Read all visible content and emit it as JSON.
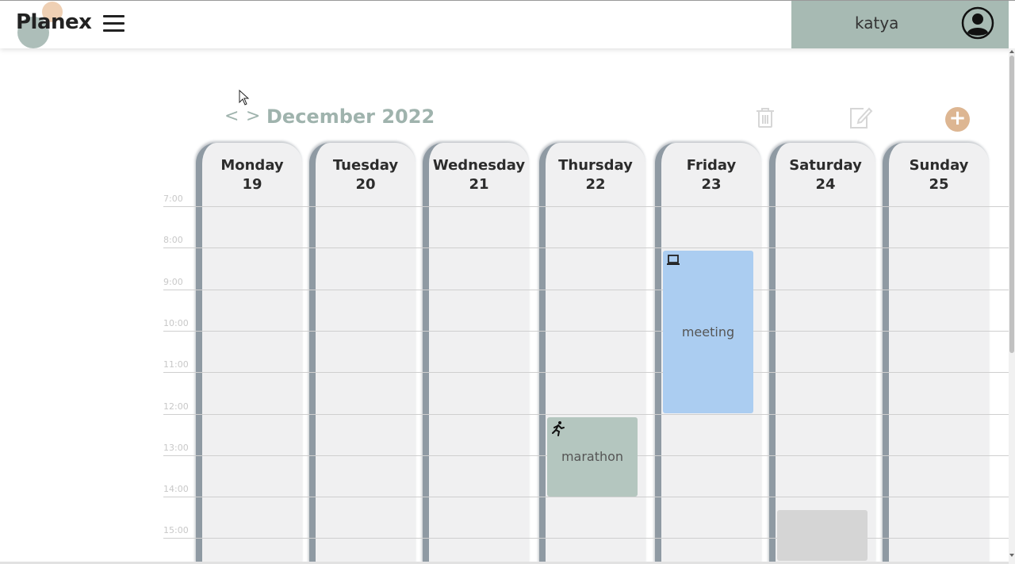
{
  "app": {
    "logo": "Planex"
  },
  "header": {
    "username": "katya"
  },
  "calendar": {
    "month_title": "December 2022",
    "prev_label": "<",
    "next_label": ">",
    "add_label": "+",
    "time_labels": [
      "7:00",
      "8:00",
      "9:00",
      "10:00",
      "11:00",
      "12:00",
      "13:00",
      "14:00",
      "15:00"
    ],
    "days": [
      {
        "name": "Monday",
        "num": "19"
      },
      {
        "name": "Tuesday",
        "num": "20"
      },
      {
        "name": "Wednesday",
        "num": "21"
      },
      {
        "name": "Thursday",
        "num": "22"
      },
      {
        "name": "Friday",
        "num": "23"
      },
      {
        "name": "Saturday",
        "num": "24"
      },
      {
        "name": "Sunday",
        "num": "25"
      }
    ],
    "events": [
      {
        "title": "meeting",
        "day": "Friday",
        "icon": "laptop-icon",
        "color": "#abcdf1",
        "start": "8:00",
        "end": "12:00"
      },
      {
        "title": "marathon",
        "day": "Thursday",
        "icon": "running-icon",
        "color": "#b4c6bf",
        "start": "12:00",
        "end": "14:00"
      },
      {
        "title": "",
        "day": "Saturday",
        "icon": "",
        "color": "#d5d5d5",
        "start": "14:15",
        "end": ""
      }
    ]
  },
  "colors": {
    "accent": "#9fb3ad",
    "add_button": "#ddb692",
    "user_box": "#a7bab3"
  }
}
